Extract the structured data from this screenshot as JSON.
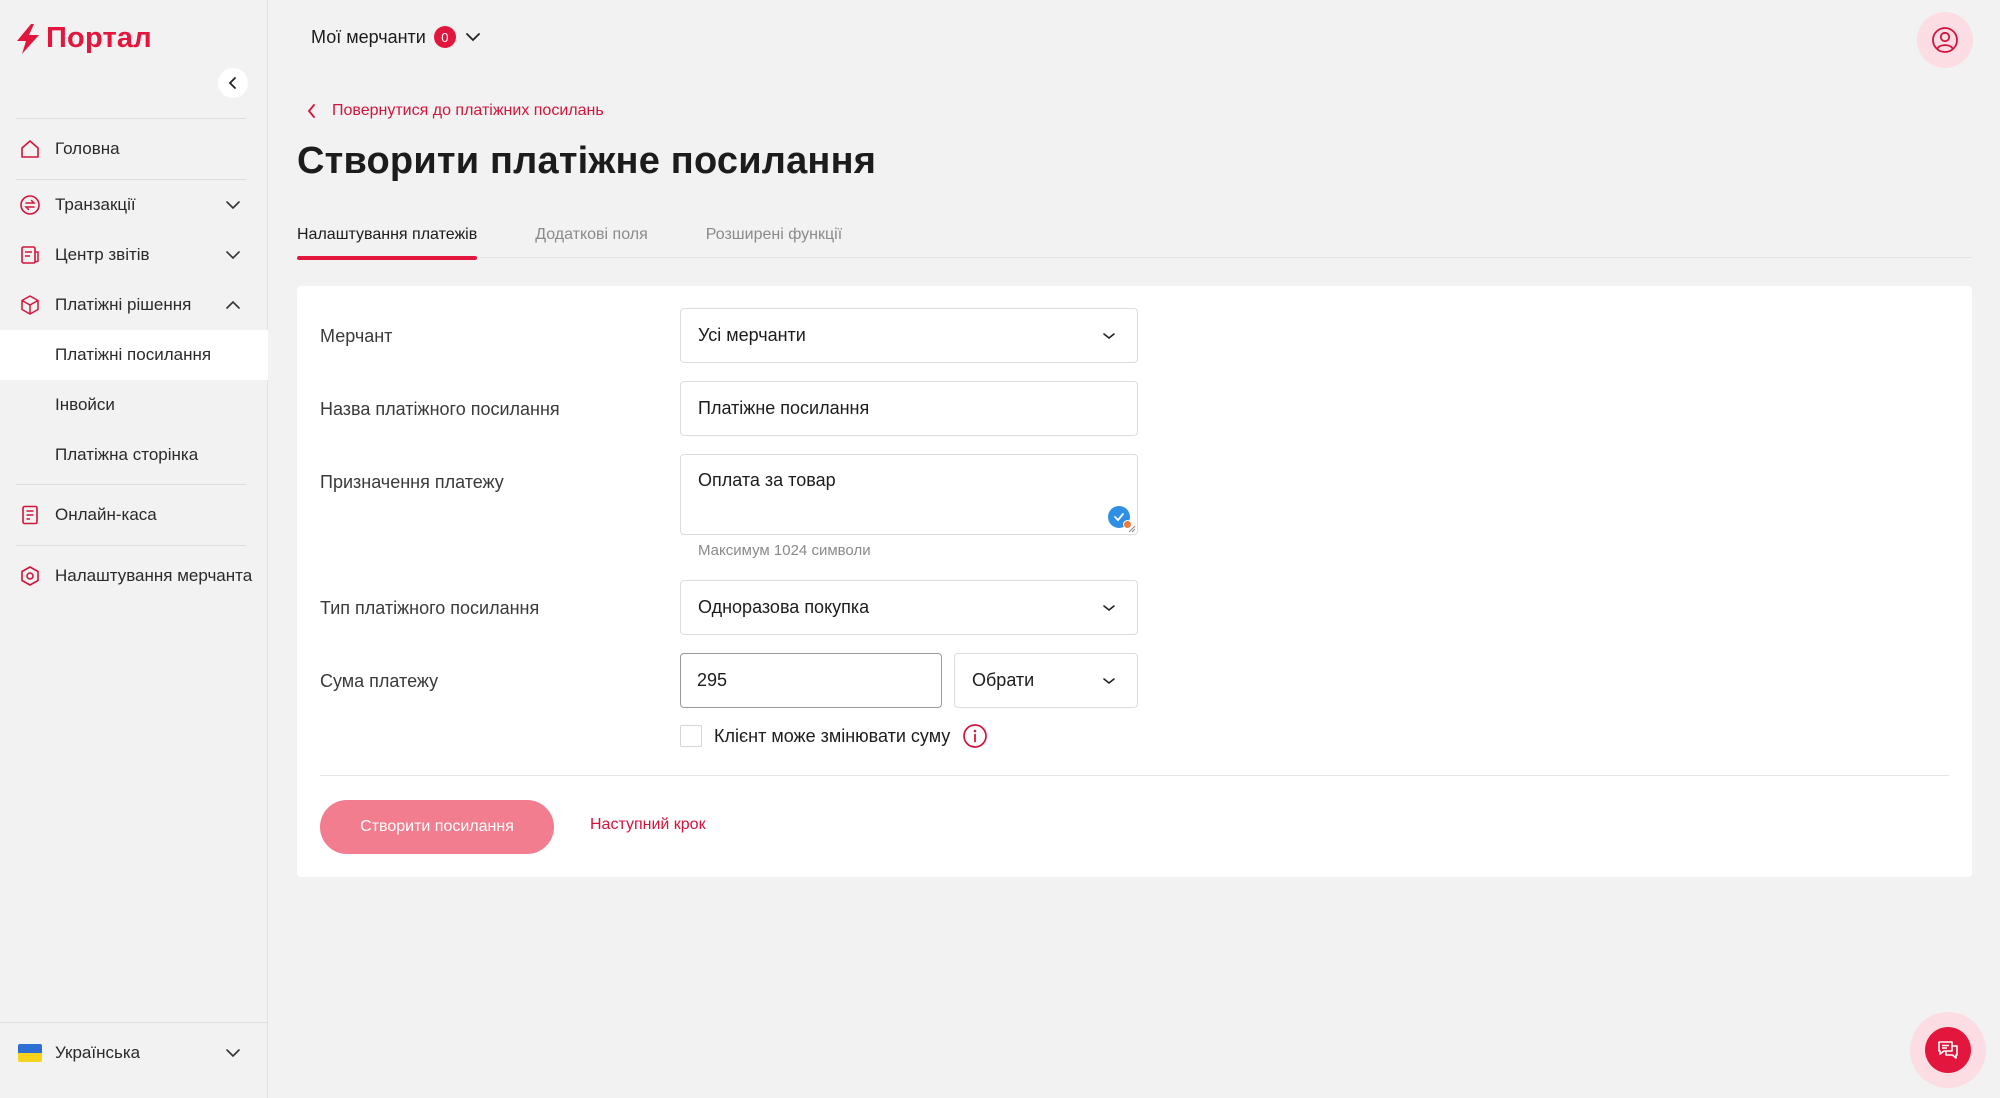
{
  "brand": {
    "name": "Портал",
    "accent": "#e3173e"
  },
  "sidebar": {
    "items": [
      {
        "label": "Головна",
        "icon": "home-icon"
      },
      {
        "label": "Транзакції",
        "icon": "exchange-icon"
      },
      {
        "label": "Центр звітів",
        "icon": "reports-icon"
      },
      {
        "label": "Платіжні рішення",
        "icon": "cube-icon"
      },
      {
        "label": "Онлайн-каса",
        "icon": "receipt-icon"
      },
      {
        "label": "Налаштування мерчанта",
        "icon": "settings-icon"
      }
    ],
    "subitems": [
      {
        "label": "Платіжні посилання",
        "active": true
      },
      {
        "label": "Інвойси"
      },
      {
        "label": "Платіжна сторінка"
      }
    ],
    "language": "Українська"
  },
  "header": {
    "merchants_label": "Мої мерчанти",
    "merchants_count": "0"
  },
  "main": {
    "back_link": "Повернутися до платіжних посилань",
    "title": "Створити платіжне посилання",
    "tabs": [
      {
        "label": "Налаштування платежів",
        "active": true
      },
      {
        "label": "Додаткові поля"
      },
      {
        "label": "Розширені функції"
      }
    ],
    "form": {
      "merchant_label": "Мерчант",
      "merchant_value": "Усі мерчанти",
      "name_label": "Назва платіжного посилання",
      "name_value": "Платіжне посилання",
      "purpose_label": "Призначення платежу",
      "purpose_value": "Оплата за товар",
      "purpose_hint": "Максимум 1024 символи",
      "type_label": "Тип платіжного посилання",
      "type_value": "Одноразова покупка",
      "amount_label": "Сума платежу",
      "amount_value": "295",
      "currency_value": "Обрати",
      "client_change_label": "Клієнт може змінювати суму"
    },
    "actions": {
      "create_label": "Створити посилання",
      "next_label": "Наступний крок"
    }
  }
}
